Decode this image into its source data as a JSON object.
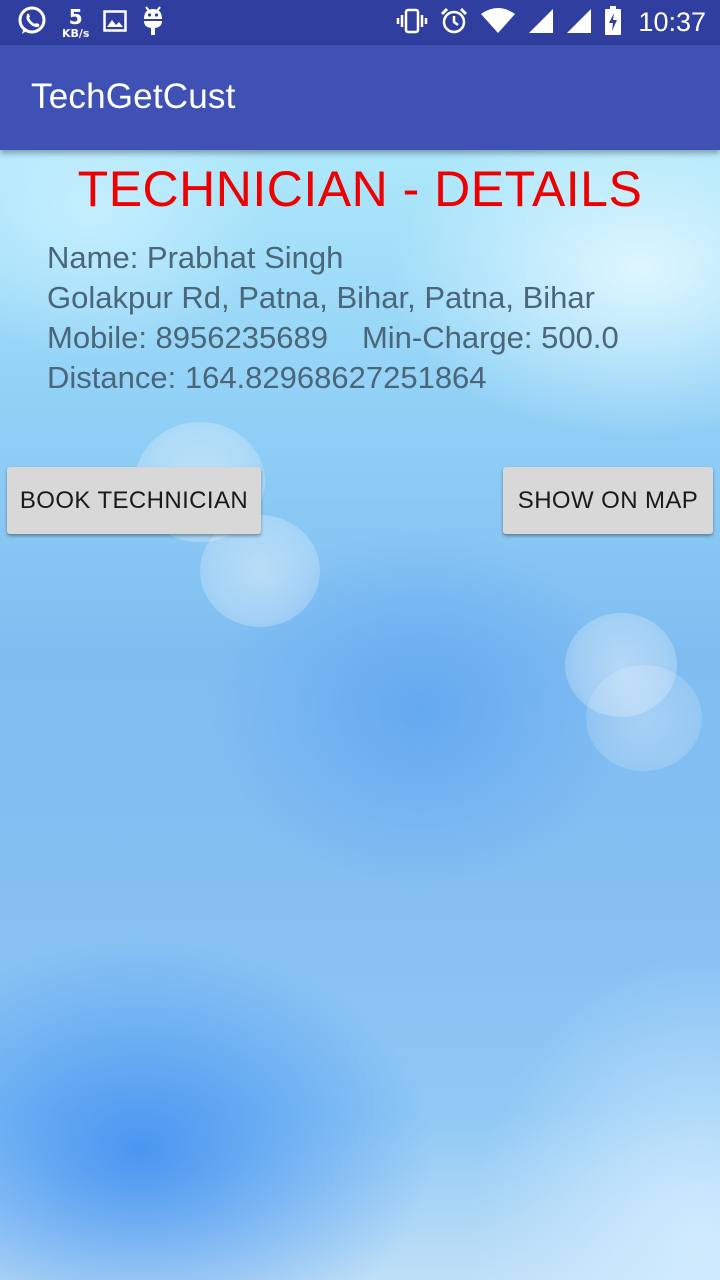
{
  "status_bar": {
    "net_speed_value": "5",
    "net_speed_unit": "KB/s",
    "time": "10:37",
    "icons_left": [
      "whatsapp-icon",
      "image-icon",
      "android-debug-icon"
    ],
    "icons_right": [
      "vibrate-icon",
      "alarm-icon",
      "wifi-icon",
      "signal-icon",
      "signal-icon",
      "battery-charging-icon"
    ]
  },
  "app_bar": {
    "title": "TechGetCust"
  },
  "main": {
    "heading": "TECHNICIAN - DETAILS",
    "name_line": "Name: Prabhat Singh",
    "address_line": "Golakpur Rd, Patna, Bihar, Patna, Bihar",
    "mobile": "Mobile: 8956235689",
    "min_charge": "Min-Charge: 500.0",
    "distance_line": "Distance: 164.82968627251864",
    "book_button_label": "BOOK TECHNICIAN",
    "map_button_label": "SHOW ON MAP"
  },
  "colors": {
    "status_bar": "#303F9F",
    "app_bar": "#3F51B5",
    "heading": "#EE0000",
    "detail_text": "#4A6678",
    "button_bg": "#D8D8D8"
  }
}
